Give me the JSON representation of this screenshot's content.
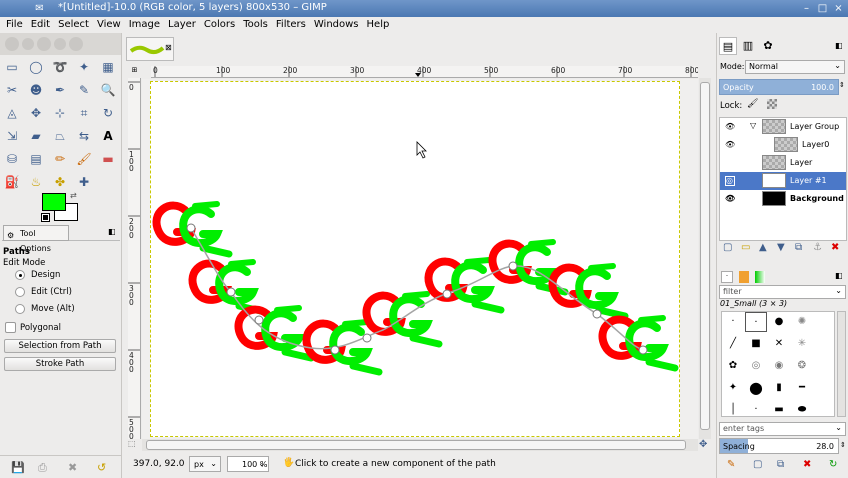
{
  "window": {
    "title": "*[Untitled]-10.0 (RGB color, 5 layers) 800x530 – GIMP"
  },
  "menu": [
    "File",
    "Edit",
    "Select",
    "View",
    "Image",
    "Layer",
    "Colors",
    "Tools",
    "Filters",
    "Windows",
    "Help"
  ],
  "tool_options": {
    "tab_label": "Tool Options",
    "title": "Paths",
    "edit_mode_label": "Edit Mode",
    "modes": [
      "Design",
      "Edit (Ctrl)",
      "Move (Alt)"
    ],
    "polygonal_label": "Polygonal",
    "selection_from_path": "Selection from Path",
    "stroke_path": "Stroke Path"
  },
  "colors": {
    "foreground": "#00ff00",
    "background": "#ffffff"
  },
  "ruler": {
    "h_ticks": [
      "0",
      "100",
      "200",
      "300",
      "400",
      "500",
      "600",
      "700",
      "800"
    ],
    "v_ticks": [
      "0",
      "100",
      "200",
      "300",
      "400",
      "500"
    ]
  },
  "status": {
    "coords": "397.0, 92.0",
    "unit": "px",
    "zoom": "100 %",
    "message": "Click to create a new component of the path"
  },
  "layers_panel": {
    "mode_label": "Mode:",
    "mode_value": "Normal",
    "opacity_label": "Opacity",
    "opacity_value": "100.0",
    "lock_label": "Lock:",
    "layers": [
      {
        "name": "Layer Group",
        "indent": 0
      },
      {
        "name": "Layer0",
        "indent": 1
      },
      {
        "name": "Layer",
        "indent": 0
      },
      {
        "name": "Layer #1",
        "indent": 0
      },
      {
        "name": "Background",
        "indent": 0
      }
    ]
  },
  "brushes_panel": {
    "filter_placeholder": "filter",
    "brush_name": "01_Small (3 × 3)",
    "tags_placeholder": "enter tags",
    "spacing_label": "Spacing",
    "spacing_value": "28.0"
  }
}
